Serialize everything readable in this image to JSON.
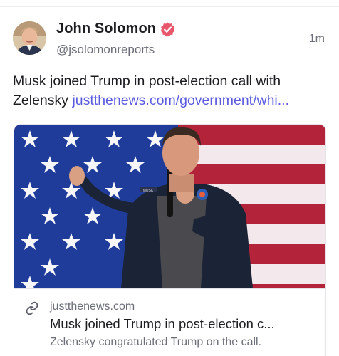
{
  "author": {
    "name": "John Solomon",
    "handle": "@jsolomonreports",
    "verified_icon": "verified-badge-icon",
    "badge_color": "#e8566b"
  },
  "post": {
    "timestamp": "1m",
    "text": "Musk joined Trump in post-election call with Zelensky ",
    "link_text": "justthenews.com/government/whi...",
    "link_color": "#5b5be0"
  },
  "link_card": {
    "domain": "justthenews.com",
    "title": "Musk joined Trump in post-election c...",
    "description": "Zelensky congratulated Trump on the call.",
    "domain_icon": "link-icon",
    "image_patch_text": "MUSK"
  }
}
